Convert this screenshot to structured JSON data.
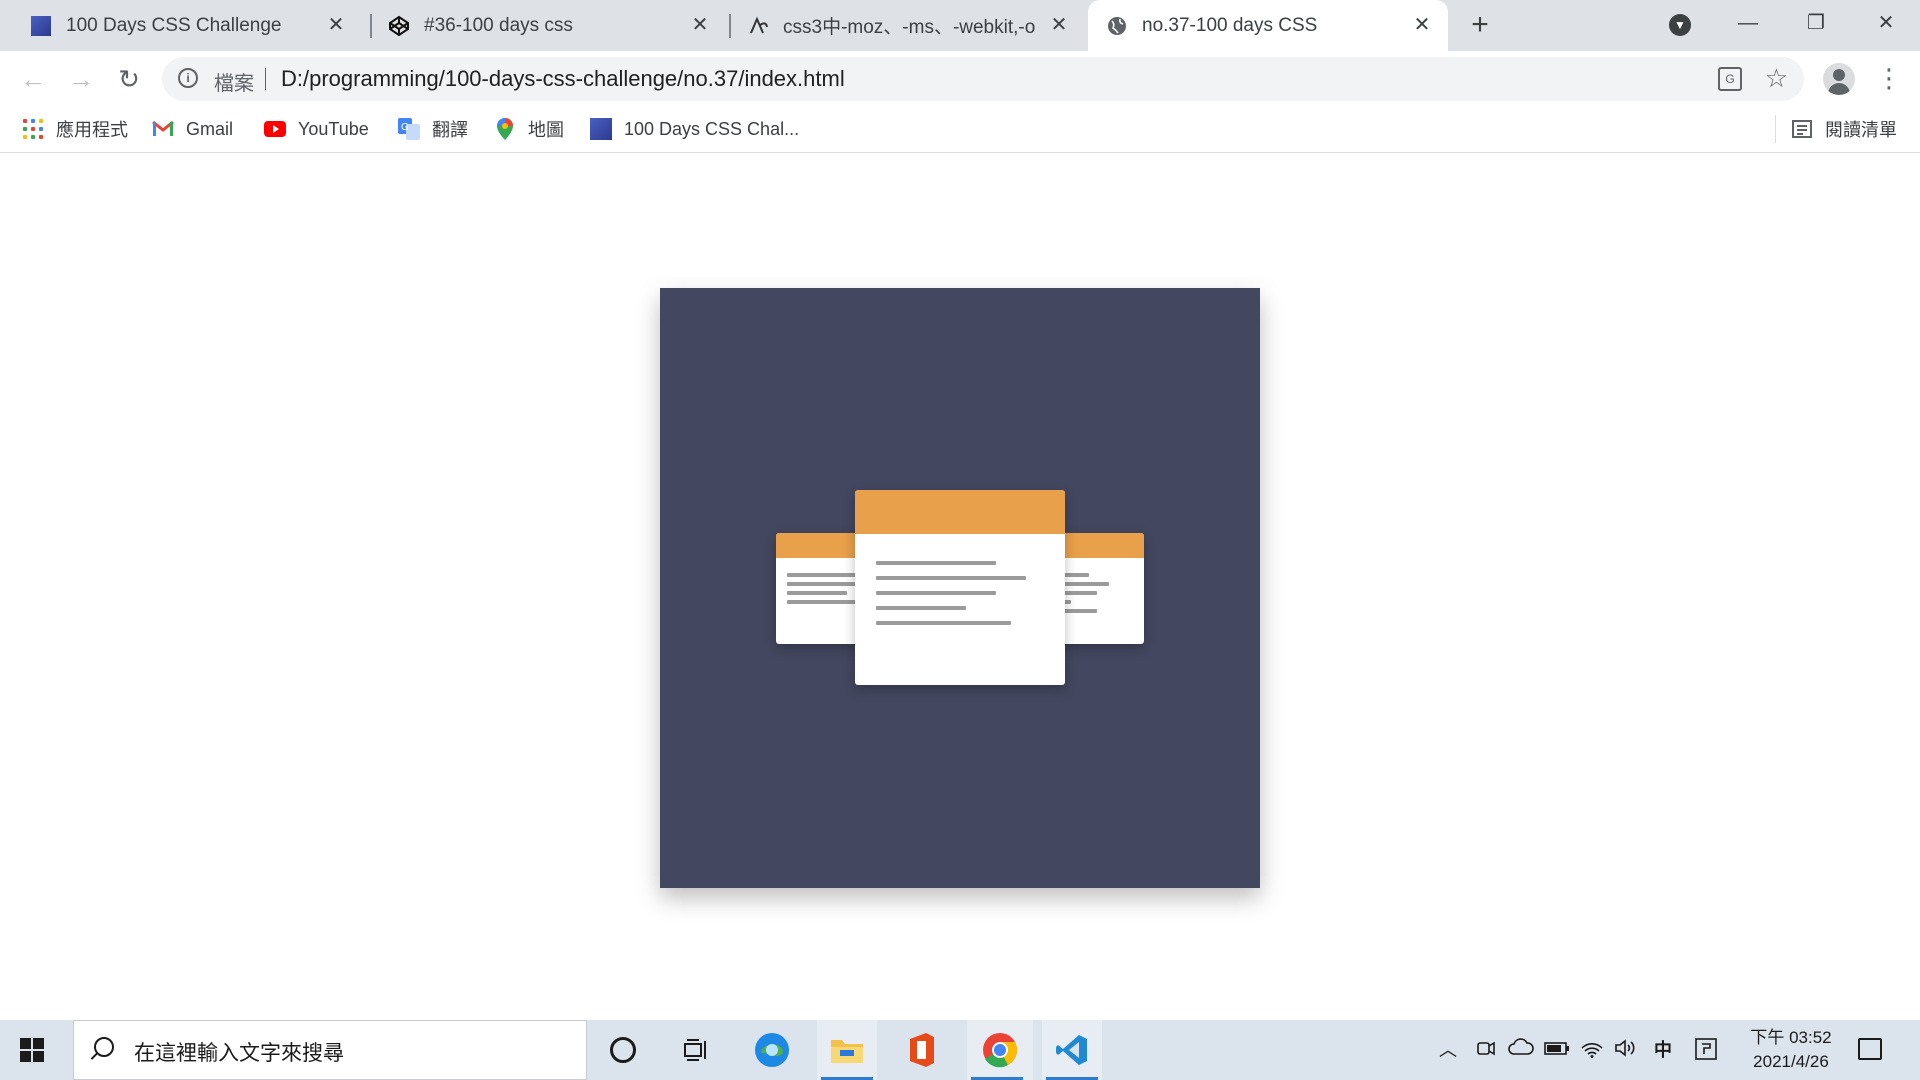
{
  "tabs": [
    {
      "title": "100 Days CSS Challenge",
      "icon": "blue-square-favicon"
    },
    {
      "title": "#36-100 days css",
      "icon": "codepen-icon"
    },
    {
      "title": "css3中-moz、-ms、-webkit,-o",
      "icon": "tool-favicon"
    },
    {
      "title": "no.37-100 days CSS",
      "icon": "globe-icon",
      "active": true
    }
  ],
  "toolbar": {
    "scheme_label": "檔案",
    "url": "D:/programming/100-days-css-challenge/no.37/index.html"
  },
  "bookmarks": [
    {
      "label": "應用程式",
      "icon": "apps-grid-icon"
    },
    {
      "label": "Gmail",
      "icon": "gmail-icon"
    },
    {
      "label": "YouTube",
      "icon": "youtube-icon"
    },
    {
      "label": "翻譯",
      "icon": "google-translate-icon"
    },
    {
      "label": "地圖",
      "icon": "google-maps-icon"
    },
    {
      "label": "100 Days CSS Chal...",
      "icon": "blue-square-favicon"
    }
  ],
  "reading_list": {
    "label": "閱讀清單",
    "icon": "reading-list-icon"
  },
  "taskbar": {
    "search_placeholder": "在這裡輸入文字來搜尋",
    "ime_label": "中",
    "time": "下午 03:52",
    "date": "2021/4/26"
  },
  "colors": {
    "frame_bg": "#43475f",
    "card_header": "#e9a04a",
    "card_bg": "#ffffff",
    "text_line": "#9b9b9b"
  }
}
